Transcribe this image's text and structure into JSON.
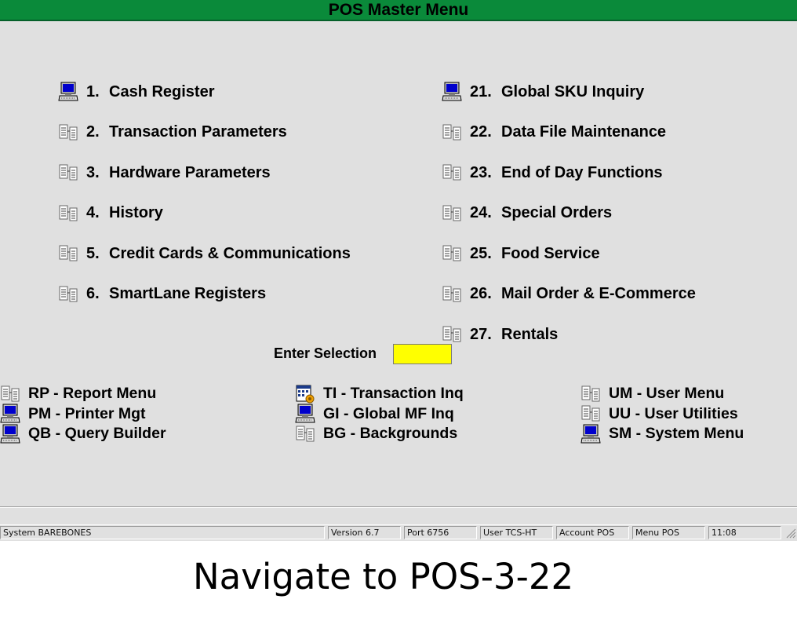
{
  "window": {
    "title": "POS Master Menu"
  },
  "menu": {
    "left": [
      {
        "num": "1.",
        "label": "Cash Register",
        "icon": "computer-icon"
      },
      {
        "num": "2.",
        "label": "Transaction Parameters",
        "icon": "submenu-icon"
      },
      {
        "num": "3.",
        "label": "Hardware Parameters",
        "icon": "submenu-icon"
      },
      {
        "num": "4.",
        "label": "History",
        "icon": "submenu-icon"
      },
      {
        "num": "5.",
        "label": "Credit Cards & Communications",
        "icon": "submenu-icon"
      },
      {
        "num": "6.",
        "label": "SmartLane Registers",
        "icon": "submenu-icon"
      }
    ],
    "right": [
      {
        "num": "21.",
        "label": "Global SKU Inquiry",
        "icon": "computer-icon"
      },
      {
        "num": "22.",
        "label": "Data File Maintenance",
        "icon": "submenu-icon"
      },
      {
        "num": "23.",
        "label": "End of Day Functions",
        "icon": "submenu-icon"
      },
      {
        "num": "24.",
        "label": "Special Orders",
        "icon": "submenu-icon"
      },
      {
        "num": "25.",
        "label": "Food Service",
        "icon": "submenu-icon"
      },
      {
        "num": "26.",
        "label": "Mail Order & E-Commerce",
        "icon": "submenu-icon"
      },
      {
        "num": "27.",
        "label": "Rentals",
        "icon": "submenu-icon"
      }
    ]
  },
  "selection": {
    "label": "Enter Selection",
    "value": ""
  },
  "shortcuts": {
    "col1": [
      {
        "label": "RP - Report Menu",
        "icon": "submenu-icon"
      },
      {
        "label": "PM - Printer Mgt",
        "icon": "computer-icon"
      },
      {
        "label": "QB - Query Builder",
        "icon": "computer-icon"
      }
    ],
    "col2": [
      {
        "label": "TI - Transaction Inq",
        "icon": "calculator-icon"
      },
      {
        "label": "GI - Global MF Inq",
        "icon": "computer-icon"
      },
      {
        "label": "BG - Backgrounds",
        "icon": "submenu-icon"
      }
    ],
    "col3": [
      {
        "label": "UM - User Menu",
        "icon": "submenu-icon"
      },
      {
        "label": "UU - User Utilities",
        "icon": "submenu-icon"
      },
      {
        "label": "SM - System Menu",
        "icon": "computer-icon"
      }
    ]
  },
  "status": {
    "system": "System BAREBONES",
    "version": "Version 6.7",
    "port": "Port 6756",
    "user": "User TCS-HT",
    "account": "Account POS",
    "menu": "Menu POS",
    "time": "11:08"
  },
  "caption": "Navigate to POS-3-22",
  "colors": {
    "title_bar": "#0a8a3a",
    "input_bg": "#ffff00",
    "background": "#e0e0e0"
  }
}
